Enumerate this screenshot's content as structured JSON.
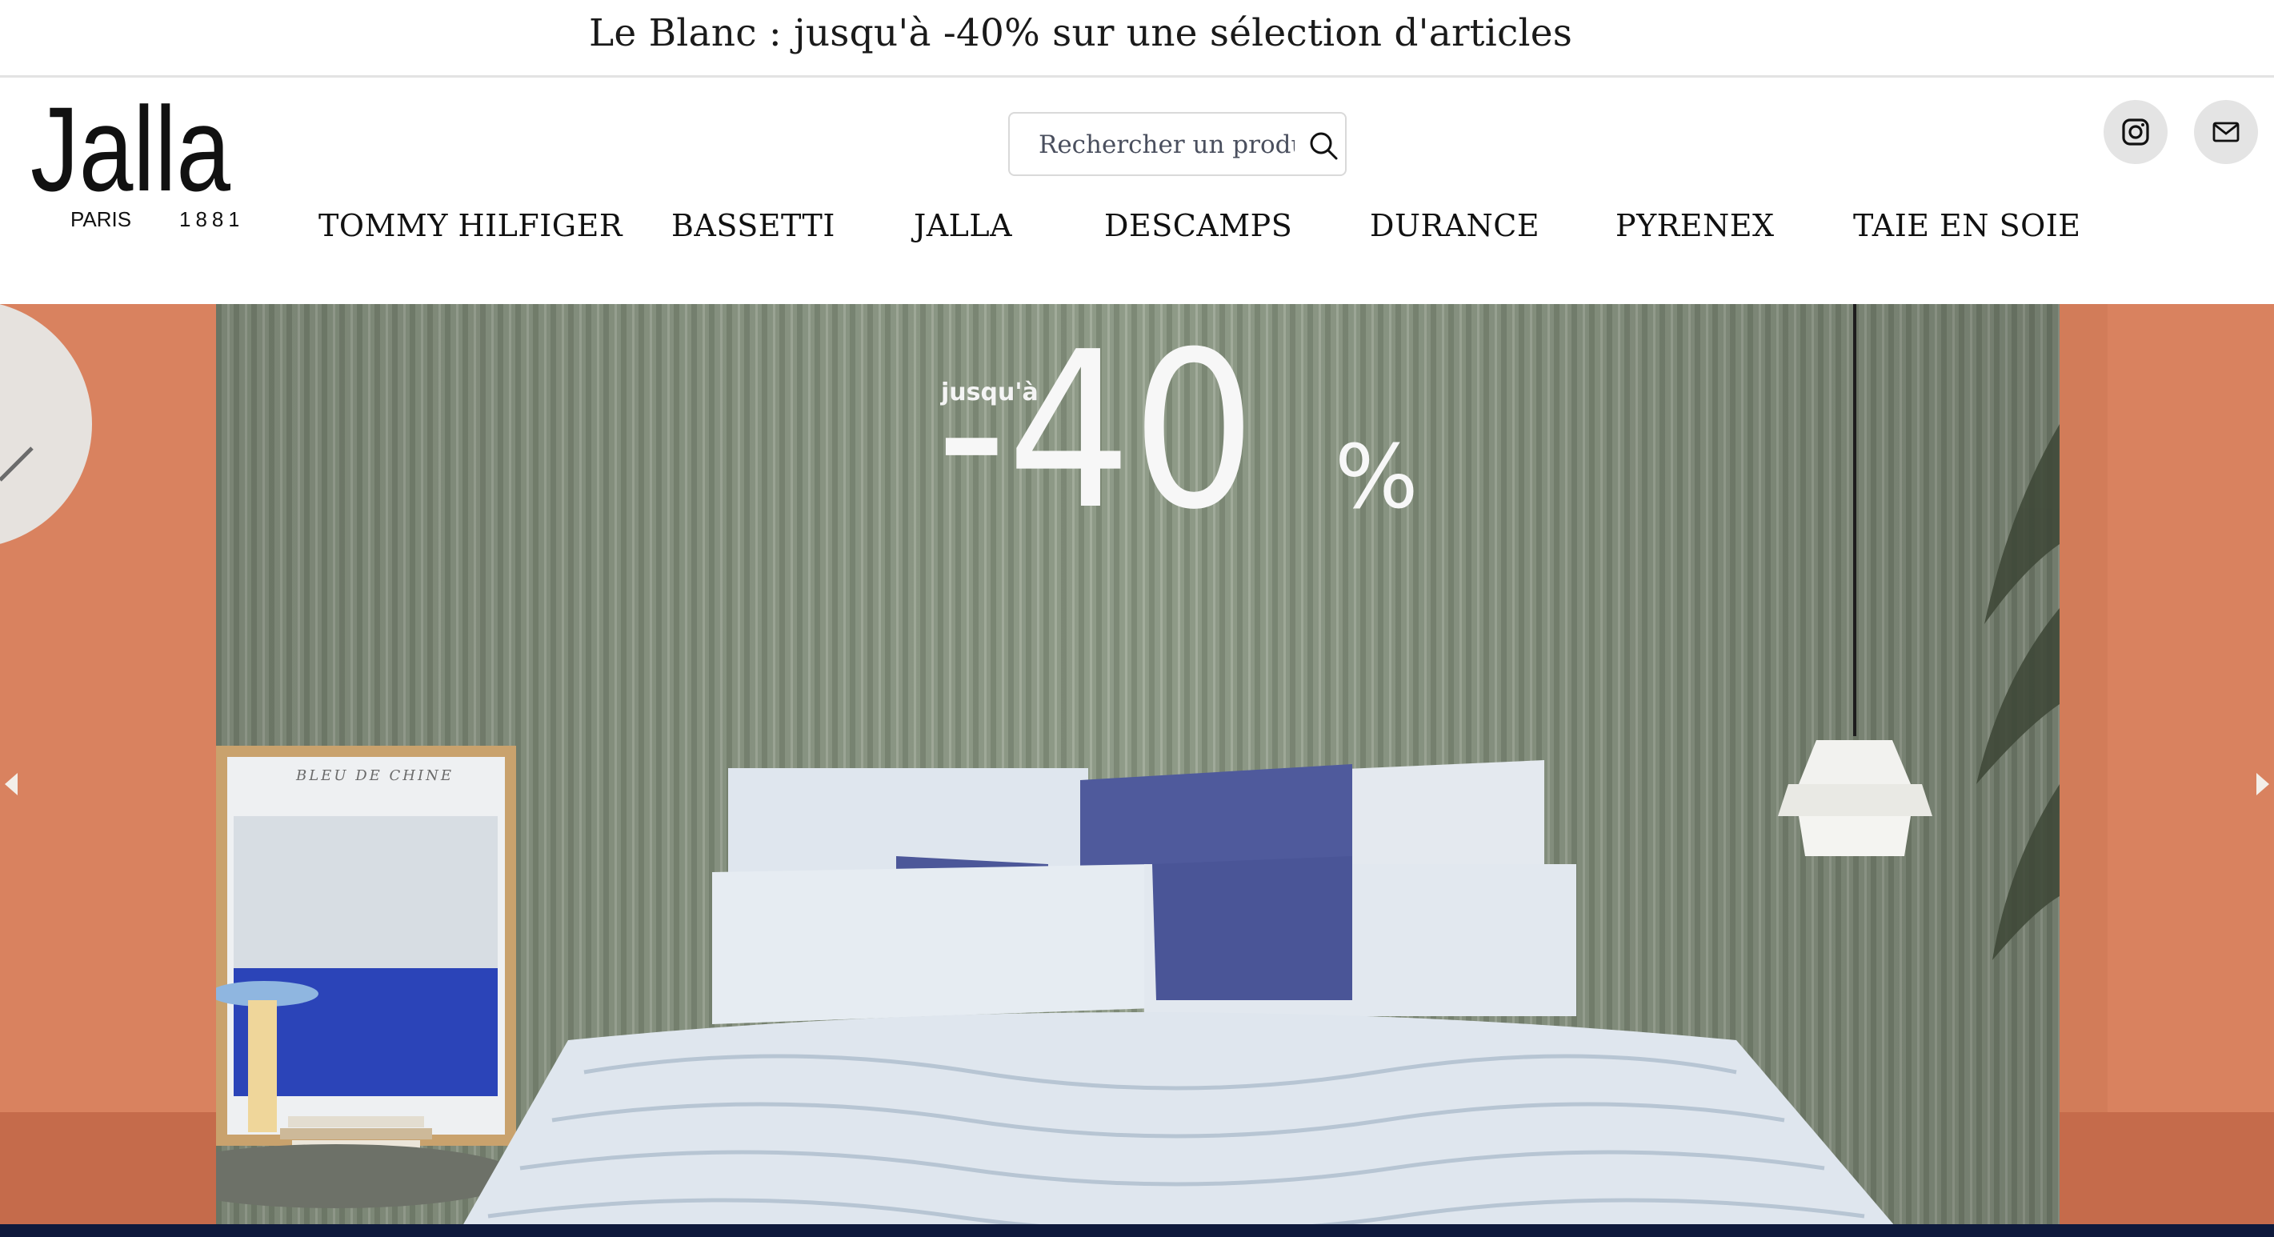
{
  "announcement": {
    "text": "Le Blanc : jusqu'à -40% sur une sélection d'articles"
  },
  "logo": {
    "name": "Jalla",
    "subtitle_left": "PARIS",
    "subtitle_right": "1881"
  },
  "search": {
    "placeholder": "Rechercher un produit",
    "value": "",
    "icon": "search-icon"
  },
  "social": {
    "instagram_icon": "instagram-icon",
    "mail_icon": "mail-icon"
  },
  "nav": {
    "items": [
      {
        "label": "TOMMY HILFIGER"
      },
      {
        "label": "BASSETTI"
      },
      {
        "label": "JALLA"
      },
      {
        "label": "DESCAMPS"
      },
      {
        "label": "DURANCE"
      },
      {
        "label": "PYRENEX"
      },
      {
        "label": "TAIE EN SOIE"
      }
    ]
  },
  "hero": {
    "promo_prefix": "jusqu'à",
    "promo_value": "-40",
    "promo_unit": "%",
    "poster_title": "BLEU DE CHINE",
    "prev_icon": "chevron-left-icon",
    "next_icon": "chevron-right-icon"
  },
  "colors": {
    "accent_blue": "#4f5a9c",
    "wall_green": "#8e9a87",
    "side_terracotta": "#d9825f",
    "footer_navy": "#0f1a3c"
  }
}
